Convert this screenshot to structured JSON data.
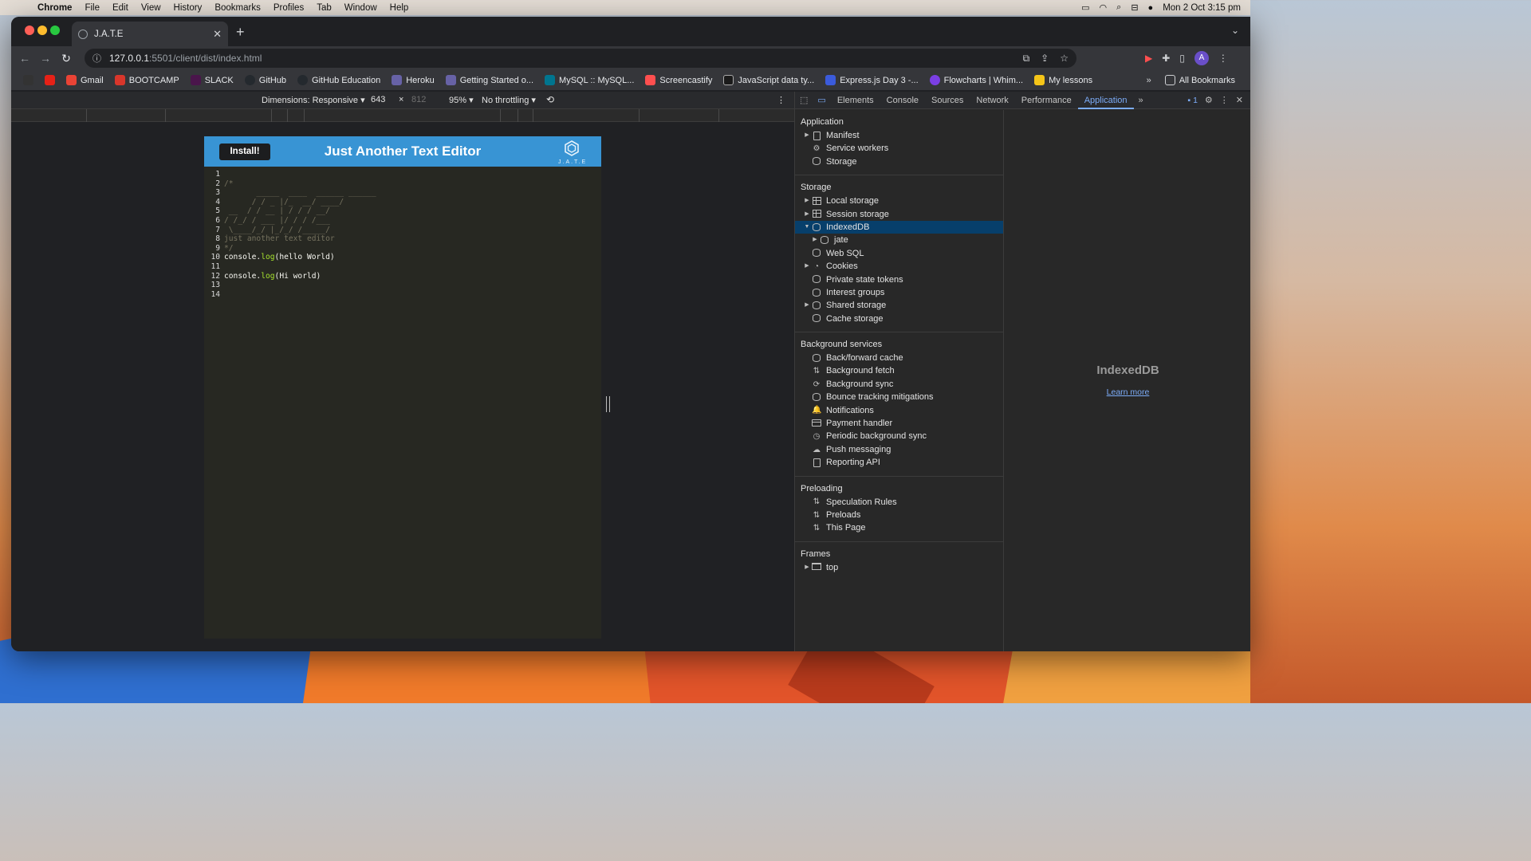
{
  "menubar": {
    "app": "Chrome",
    "menus": [
      "File",
      "Edit",
      "View",
      "History",
      "Bookmarks",
      "Profiles",
      "Tab",
      "Window",
      "Help"
    ],
    "clock": "Mon 2 Oct  3:15 pm"
  },
  "browser": {
    "tab_title": "J.A.T.E",
    "url_host": "127.0.0.1",
    "url_path": ":5501/client/dist/index.html",
    "bookmarks": [
      {
        "label": "",
        "color": "#333333"
      },
      {
        "label": "",
        "color": "#e62117"
      },
      {
        "label": "Gmail",
        "color": "#ea4335"
      },
      {
        "label": "BOOTCAMP",
        "color": "#d9362b"
      },
      {
        "label": "SLACK",
        "color": "#4a154b"
      },
      {
        "label": "GitHub",
        "color": "#24292e"
      },
      {
        "label": "GitHub Education",
        "color": "#24292e"
      },
      {
        "label": "Heroku",
        "color": "#6762a6"
      },
      {
        "label": "Getting Started o...",
        "color": "#6762a6"
      },
      {
        "label": "MySQL :: MySQL...",
        "color": "#00758f"
      },
      {
        "label": "Screencastify",
        "color": "#ff4f4f"
      },
      {
        "label": "JavaScript data ty...",
        "color": "#1b1b1b"
      },
      {
        "label": "Express.js Day 3 -...",
        "color": "#3b5bdb"
      },
      {
        "label": "Flowcharts | Whim...",
        "color": "#7b3fe4"
      },
      {
        "label": "My lessons",
        "color": "#f5c518"
      }
    ],
    "all_bookmarks": "All Bookmarks"
  },
  "device_toolbar": {
    "dimensions_label": "Dimensions: Responsive",
    "width": "643",
    "times": "×",
    "height": "812",
    "zoom": "95%",
    "throttle": "No throttling"
  },
  "app": {
    "install_label": "Install!",
    "title": "Just Another Text Editor",
    "logo_text": "J.A.T.E",
    "lines": [
      {
        "n": "1",
        "text": "",
        "type": "plain"
      },
      {
        "n": "2",
        "text": "/*",
        "type": "comment"
      },
      {
        "n": "3",
        "text": "       _____  ____  ______ ______",
        "type": "comment"
      },
      {
        "n": "4",
        "text": "      / / _ |/_  __/ ____/",
        "type": "comment"
      },
      {
        "n": "5",
        "text": " __  / / __ | / / / __/",
        "type": "comment"
      },
      {
        "n": "6",
        "text": "/ /_/ / ___ |/ / / /___",
        "type": "comment"
      },
      {
        "n": "7",
        "text": " \\____/_/ |_/_/ /_____/",
        "type": "comment"
      },
      {
        "n": "8",
        "text": "just another text editor",
        "type": "comment"
      },
      {
        "n": "9",
        "text": "*/",
        "type": "comment"
      },
      {
        "n": "10",
        "pre": "console.",
        "fn": "log",
        "post": "(hello World)",
        "type": "call"
      },
      {
        "n": "11",
        "text": "",
        "type": "plain"
      },
      {
        "n": "12",
        "pre": "console.",
        "fn": "log",
        "post": "(Hi world)",
        "type": "call"
      },
      {
        "n": "13",
        "text": "",
        "type": "plain"
      },
      {
        "n": "14",
        "text": "",
        "type": "plain"
      }
    ]
  },
  "devtools": {
    "tabs": [
      "Elements",
      "Console",
      "Sources",
      "Network",
      "Performance",
      "Application"
    ],
    "active_tab": "Application",
    "issues_badge": "1",
    "sections": [
      {
        "title": "Application",
        "items": [
          {
            "label": "Manifest",
            "icon": "doc",
            "arrow": true,
            "level": 0
          },
          {
            "label": "Service workers",
            "icon": "gears",
            "arrow": false,
            "level": 0
          },
          {
            "label": "Storage",
            "icon": "db",
            "arrow": false,
            "level": 0
          }
        ]
      },
      {
        "title": "Storage",
        "items": [
          {
            "label": "Local storage",
            "icon": "grid",
            "arrow": true,
            "level": 0
          },
          {
            "label": "Session storage",
            "icon": "grid",
            "arrow": true,
            "level": 0
          },
          {
            "label": "IndexedDB",
            "icon": "db",
            "arrow": "open",
            "level": 0,
            "selected": true
          },
          {
            "label": "jate",
            "icon": "db",
            "arrow": true,
            "level": 1
          },
          {
            "label": "Web SQL",
            "icon": "db",
            "arrow": false,
            "level": 0
          },
          {
            "label": "Cookies",
            "icon": "cookie",
            "arrow": true,
            "level": 0
          },
          {
            "label": "Private state tokens",
            "icon": "db",
            "arrow": false,
            "level": 0
          },
          {
            "label": "Interest groups",
            "icon": "db",
            "arrow": false,
            "level": 0
          },
          {
            "label": "Shared storage",
            "icon": "db",
            "arrow": true,
            "level": 0
          },
          {
            "label": "Cache storage",
            "icon": "db",
            "arrow": false,
            "level": 0
          }
        ]
      },
      {
        "title": "Background services",
        "items": [
          {
            "label": "Back/forward cache",
            "icon": "db",
            "arrow": false,
            "level": 0
          },
          {
            "label": "Background fetch",
            "icon": "updown",
            "arrow": false,
            "level": 0
          },
          {
            "label": "Background sync",
            "icon": "sync",
            "arrow": false,
            "level": 0
          },
          {
            "label": "Bounce tracking mitigations",
            "icon": "db",
            "arrow": false,
            "level": 0
          },
          {
            "label": "Notifications",
            "icon": "bell",
            "arrow": false,
            "level": 0
          },
          {
            "label": "Payment handler",
            "icon": "card",
            "arrow": false,
            "level": 0
          },
          {
            "label": "Periodic background sync",
            "icon": "clock",
            "arrow": false,
            "level": 0
          },
          {
            "label": "Push messaging",
            "icon": "cloud",
            "arrow": false,
            "level": 0
          },
          {
            "label": "Reporting API",
            "icon": "doc",
            "arrow": false,
            "level": 0
          }
        ]
      },
      {
        "title": "Preloading",
        "items": [
          {
            "label": "Speculation Rules",
            "icon": "updown",
            "arrow": false,
            "level": 0
          },
          {
            "label": "Preloads",
            "icon": "updown",
            "arrow": false,
            "level": 0
          },
          {
            "label": "This Page",
            "icon": "updown",
            "arrow": false,
            "level": 0
          }
        ]
      },
      {
        "title": "Frames",
        "items": [
          {
            "label": "top",
            "icon": "frame",
            "arrow": true,
            "level": 0
          }
        ]
      }
    ],
    "main_title": "IndexedDB",
    "learn_more": "Learn more"
  }
}
